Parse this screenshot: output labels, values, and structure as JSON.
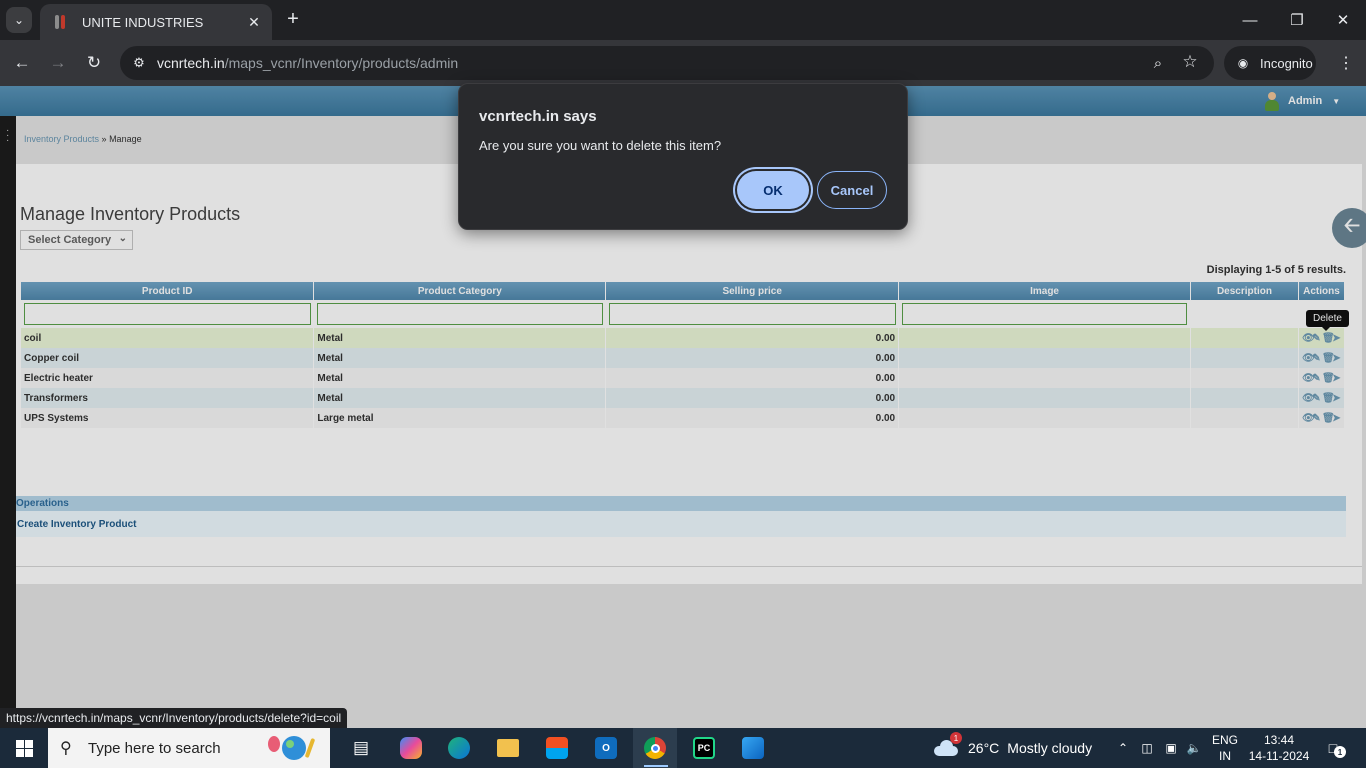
{
  "browser": {
    "tab_title": "UNITE INDUSTRIES",
    "url_host": "vcnrtech.in",
    "url_path": "/maps_vcnr/Inventory/products/admin",
    "profile_label": "Incognito",
    "status_url": "https://vcnrtech.in/maps_vcnr/Inventory/products/delete?id=coil"
  },
  "header": {
    "user_label": "Admin"
  },
  "breadcrumb": {
    "parent": "Inventory Products",
    "separator": " » ",
    "current": "Manage"
  },
  "page": {
    "title": "Manage Inventory Products",
    "category_select": "Select Category",
    "summary": "Displaying 1-5 of 5 results."
  },
  "grid": {
    "columns": [
      "Product ID",
      "Product Category",
      "Selling price",
      "Image",
      "Description",
      "Actions"
    ],
    "rows": [
      {
        "id": "coil",
        "category": "Metal",
        "price": "0.00"
      },
      {
        "id": "Copper coil",
        "category": "Metal",
        "price": "0.00"
      },
      {
        "id": "Electric heater",
        "category": "Metal",
        "price": "0.00"
      },
      {
        "id": "Transformers",
        "category": "Metal",
        "price": "0.00"
      },
      {
        "id": "UPS Systems",
        "category": "Large metal",
        "price": "0.00"
      }
    ],
    "tooltip": "Delete"
  },
  "operations": {
    "title": "Operations",
    "create_link": "Create Inventory Product"
  },
  "dialog": {
    "title": "vcnrtech.in says",
    "message": "Are you sure you want to delete this item?",
    "ok_label": "OK",
    "cancel_label": "Cancel"
  },
  "taskbar": {
    "search_placeholder": "Type here to search",
    "weather_temp": "26°C",
    "weather_text": "Mostly cloudy",
    "weather_badge": "1",
    "lang_line1": "ENG",
    "lang_line2": "IN",
    "time": "13:44",
    "date": "14-11-2024",
    "notification_count": "1"
  },
  "colors": {
    "header_blue": "#3d7aa0",
    "grid_header": "#5189ae",
    "dialog_bg": "#292a2d",
    "ok_button": "#a8c7fa",
    "row_highlight": "#ecf7d9"
  }
}
